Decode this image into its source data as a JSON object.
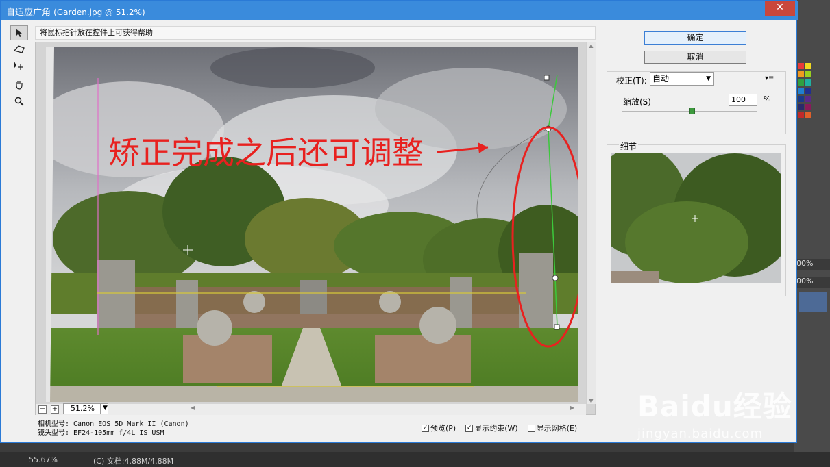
{
  "dialog": {
    "title": "自适应广角",
    "subtitle": "(Garden.jpg @ 51.2%)",
    "close_label": "✕"
  },
  "help_text": "将鼠标指针放在控件上可获得帮助",
  "buttons": {
    "ok": "确定",
    "cancel": "取消"
  },
  "correction": {
    "label": "校正(T):",
    "value": "自动",
    "scale_label": "缩放(S)",
    "scale_value": "100",
    "scale_unit": "%",
    "scale_fraction": 0.5
  },
  "detail": {
    "label": "细节"
  },
  "zoom": {
    "value": "51.2%",
    "minus": "−",
    "plus": "+"
  },
  "meta": {
    "camera": "相机型号: Canon EOS 5D Mark II (Canon)",
    "lens": "镜头型号: EF24-105mm f/4L IS USM"
  },
  "options": [
    {
      "label": "预览(P)",
      "checked": true
    },
    {
      "label": "显示约束(W)",
      "checked": true
    },
    {
      "label": "显示网格(E)",
      "checked": false
    }
  ],
  "annotation": "矫正完成之后还可调整",
  "status": {
    "zoom": "55.67%",
    "doc": "(C) 文档:4.88M/4.88M"
  },
  "ps_right": {
    "pct1": "00%",
    "pct2": "00%"
  },
  "watermark": {
    "logo": "Baidu经验",
    "url": "jingyan.baidu.com"
  },
  "colors": {
    "accent": "#3a8bdc",
    "annotation": "#e8211f",
    "constraint_green": "#3cc83c",
    "constraint_yellow": "#d8c83a"
  }
}
